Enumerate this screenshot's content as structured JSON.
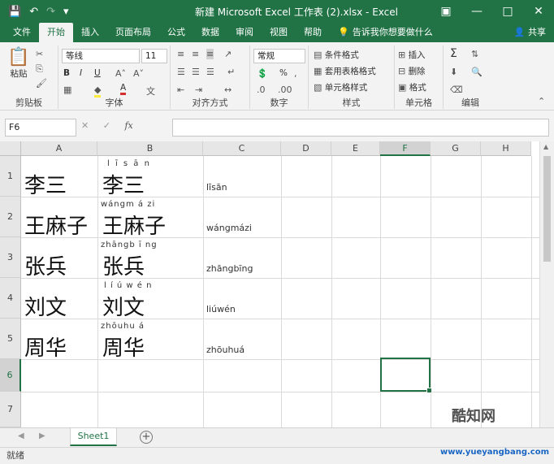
{
  "titlebar": {
    "title": "新建 Microsoft Excel 工作表 (2).xlsx  -  Excel",
    "save_icon": "save-icon",
    "undo_icon": "undo-icon",
    "redo_icon": "redo-icon",
    "customize_icon": "customize-qat-icon"
  },
  "tabs": [
    "文件",
    "开始",
    "插入",
    "页面布局",
    "公式",
    "数据",
    "审阅",
    "视图",
    "帮助"
  ],
  "tell_me": "告诉我你想要做什么",
  "share": "共享",
  "ribbon": {
    "clipboard": {
      "label": "剪贴板",
      "paste": "粘贴"
    },
    "font": {
      "label": "字体",
      "font_name": "等线",
      "font_size": "11"
    },
    "alignment": {
      "label": "对齐方式"
    },
    "number": {
      "label": "数字",
      "format": "常规",
      "percent": "%"
    },
    "styles": {
      "label": "样式",
      "conditional": "条件格式",
      "table": "套用表格格式",
      "cell_styles": "单元格样式"
    },
    "cells": {
      "label": "单元格",
      "insert": "插入",
      "delete": "删除",
      "format": "格式"
    },
    "editing": {
      "label": "编辑"
    }
  },
  "formula_bar": {
    "name_box": "F6",
    "fx": "fx",
    "content": ""
  },
  "columns": [
    "A",
    "B",
    "C",
    "D",
    "E",
    "F",
    "G",
    "H"
  ],
  "rows": [
    "1",
    "2",
    "3",
    "4",
    "5",
    "6",
    "7"
  ],
  "cells": {
    "A": [
      "李三",
      "王麻子",
      "张兵",
      "刘文",
      "周华"
    ],
    "B": [
      "李三",
      "王麻子",
      "张兵",
      "刘文",
      "周华"
    ],
    "B_ruby": [
      "l ī s ā n",
      "wángm á  zi",
      "zhāngb ī ng",
      "l í  ú w é n",
      "zhōuhu á"
    ],
    "C": [
      "līsān",
      "wángmázi",
      "zhāngbīng",
      "liúwén",
      "zhōuhuá"
    ]
  },
  "sheet_tabs": [
    "Sheet1"
  ],
  "status": "就绪",
  "watermark": {
    "brand": "酷知网",
    "site": "www.yueyangbang.com"
  }
}
